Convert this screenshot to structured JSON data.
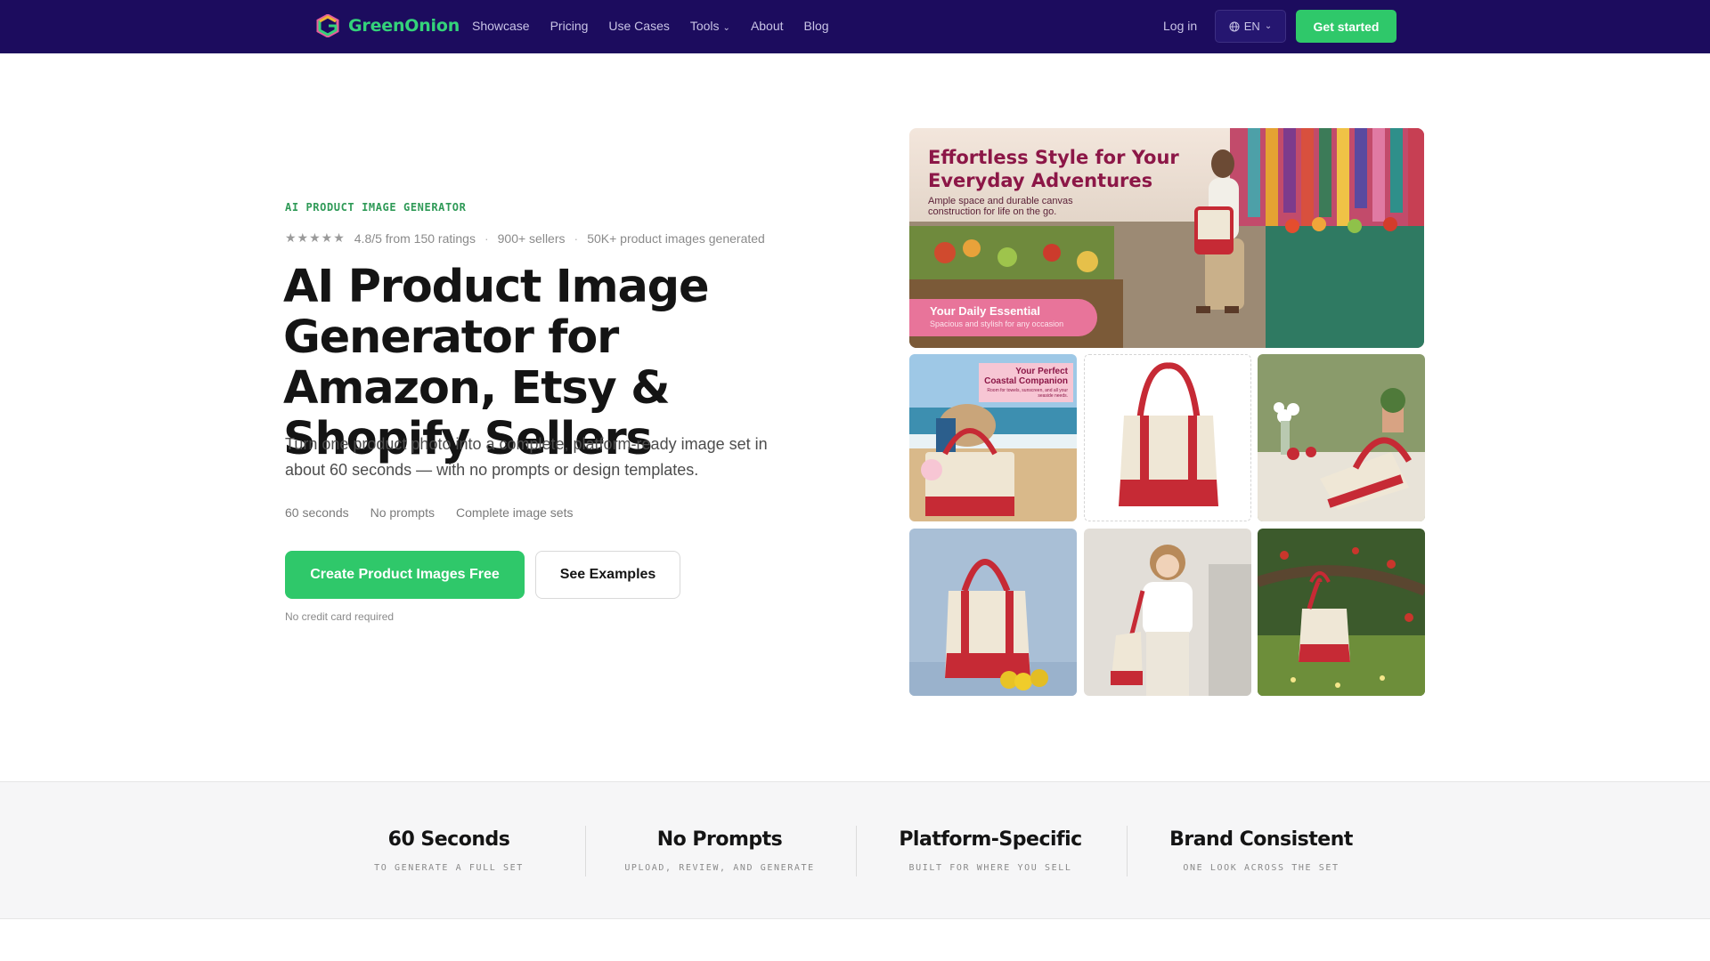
{
  "nav": {
    "brand": "GreenOnion",
    "links": [
      "Showcase",
      "Pricing",
      "Use Cases",
      "Tools",
      "About",
      "Blog"
    ],
    "login": "Log in",
    "language": "EN",
    "cta": "Get started",
    "colors": {
      "background": "#1c0c5e",
      "accent": "#2fc86a"
    }
  },
  "hero": {
    "eyebrow": "AI PRODUCT IMAGE GENERATOR",
    "stars": "★★★★★",
    "rating": "4.8/5 from 150 ratings",
    "sellers": "900+ sellers",
    "generated": "50K+ product images generated",
    "title": "AI Product Image Generator for Amazon, Etsy & Shopify Sellers",
    "subtitle": "Turn one product photo into a complete, platform-ready image set in about 60 seconds — with no prompts or design templates.",
    "chips": [
      "60 seconds",
      "No prompts",
      "Complete image sets"
    ],
    "primary_cta": "Create Product Images Free",
    "secondary_cta": "See Examples",
    "note": "No credit card required"
  },
  "gallery": {
    "banner_title": "Effortless Style for Your Everyday Adventures",
    "banner_subtitle": "Ample space and durable canvas construction for life on the go.",
    "pill_title": "Your Daily Essential",
    "pill_subtitle": "Spacious and stylish for any occasion",
    "coastal_title": "Your Perfect Coastal Companion",
    "coastal_subtitle": "Room for towels, sunscreen, and all your seaside needs."
  },
  "stats": [
    {
      "title": "60 Seconds",
      "subtitle": "TO GENERATE A FULL SET"
    },
    {
      "title": "No Prompts",
      "subtitle": "UPLOAD, REVIEW, AND GENERATE"
    },
    {
      "title": "Platform-Specific",
      "subtitle": "BUILT FOR WHERE YOU SELL"
    },
    {
      "title": "Brand Consistent",
      "subtitle": "ONE LOOK ACROSS THE SET"
    }
  ]
}
